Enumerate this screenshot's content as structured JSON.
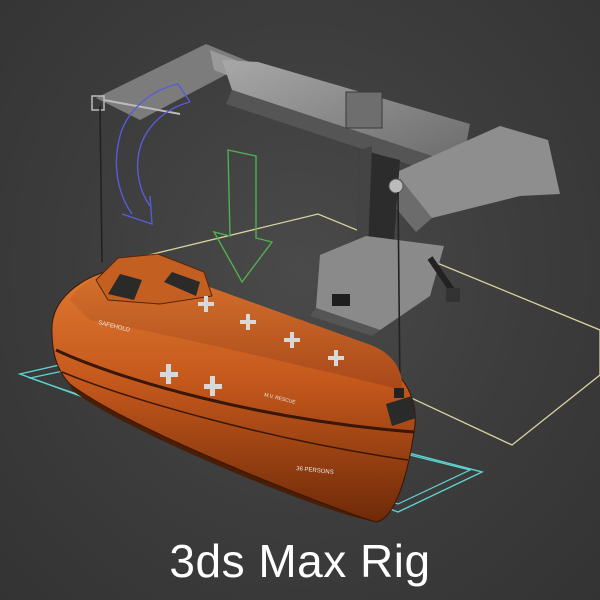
{
  "caption": "3ds Max Rig",
  "boat": {
    "side_text": "SAFEHOLD",
    "hull_marking": "36 PERSONS",
    "panel_text": "M.V. RESCUE"
  },
  "colors": {
    "background": "#3d3d3d",
    "hull": "#c4581c",
    "crane": "#8c8c8c",
    "ground_plane": "#d8d4a0",
    "boat_footprint": "#5fd3d0",
    "move_gizmo": "#4fb04f",
    "rotate_gizmo": "#5a5ad8",
    "caption_text": "#ffffff"
  },
  "icons": [
    "rotate-arrow-icon",
    "move-arrow-icon"
  ]
}
